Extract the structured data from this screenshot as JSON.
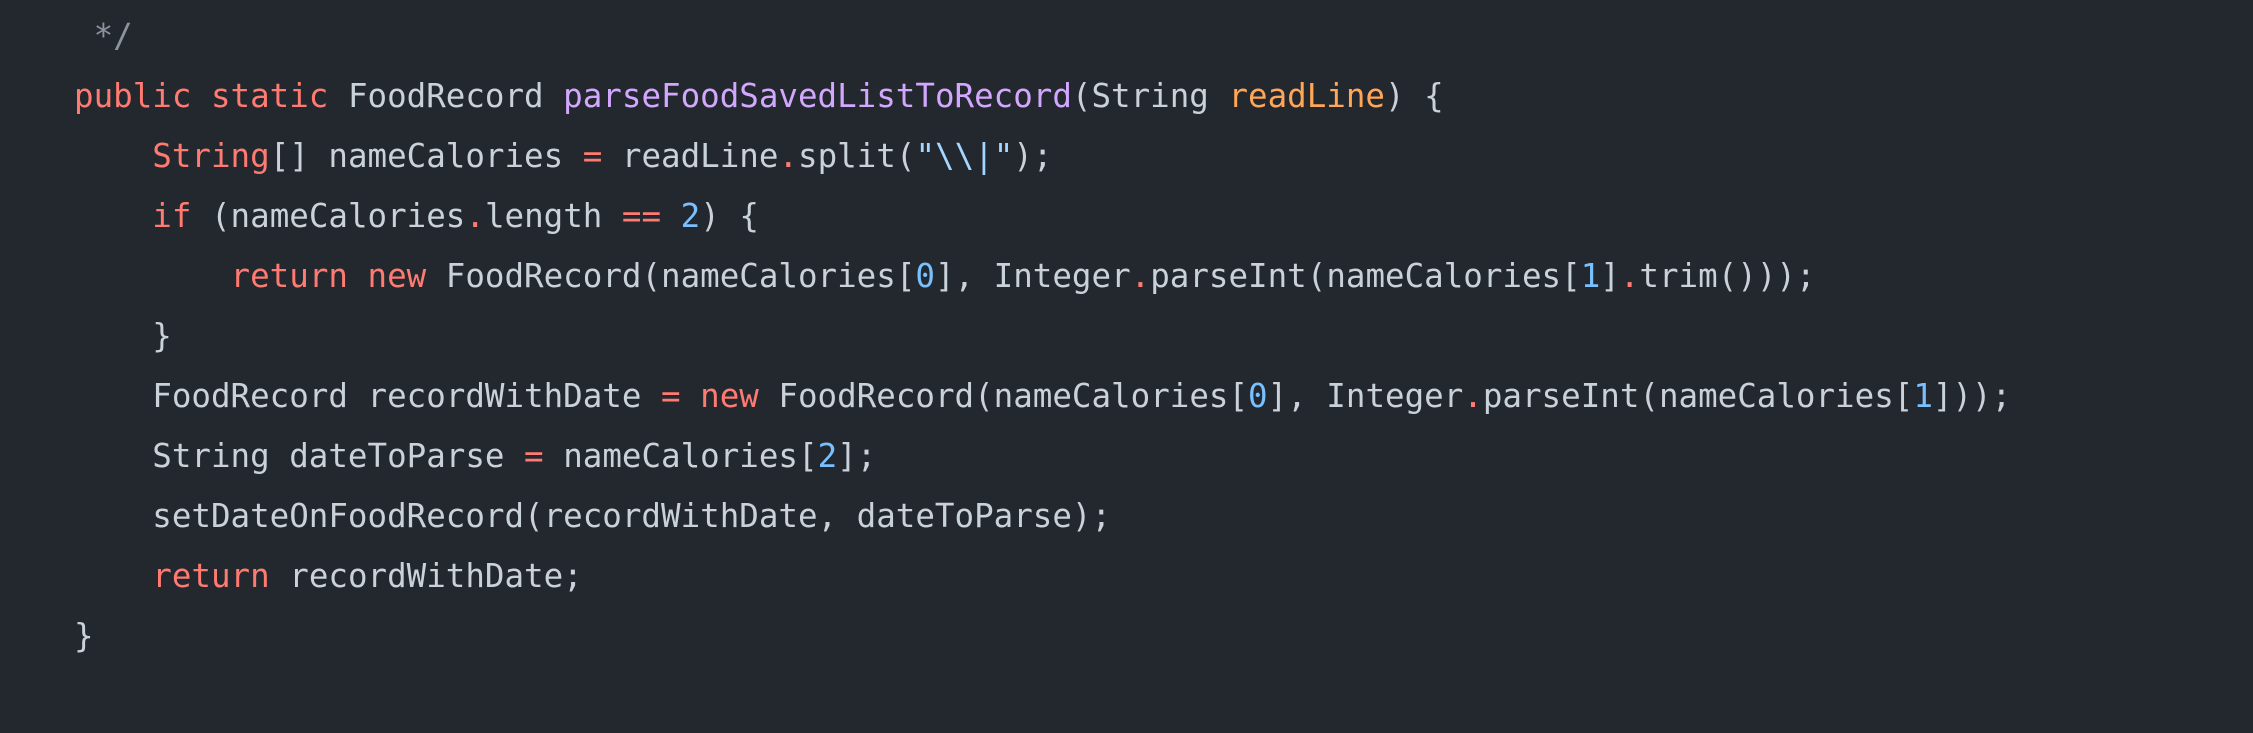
{
  "colors": {
    "background": "#23272e",
    "plain": "#c9d1d9",
    "comment": "#8b949e",
    "keyword": "#ff7b72",
    "function": "#d2a8ff",
    "parameter": "#ffa657",
    "string": "#a5d6ff",
    "number": "#79c0ff"
  },
  "code": {
    "lines": [
      [
        {
          "text": " */",
          "kind": "comment"
        }
      ],
      [
        {
          "text": "public static ",
          "kind": "keyword"
        },
        {
          "text": "FoodRecord ",
          "kind": "plain"
        },
        {
          "text": "parseFoodSavedListToRecord",
          "kind": "function"
        },
        {
          "text": "(String ",
          "kind": "plain"
        },
        {
          "text": "readLine",
          "kind": "parameter"
        },
        {
          "text": ") {",
          "kind": "plain"
        }
      ],
      [
        {
          "text": "    ",
          "kind": "plain"
        },
        {
          "text": "String",
          "kind": "keyword"
        },
        {
          "text": "[] nameCalories ",
          "kind": "plain"
        },
        {
          "text": "=",
          "kind": "keyword"
        },
        {
          "text": " readLine",
          "kind": "plain"
        },
        {
          "text": ".",
          "kind": "keyword"
        },
        {
          "text": "split(",
          "kind": "plain"
        },
        {
          "text": "\"\\\\|\"",
          "kind": "string"
        },
        {
          "text": ");",
          "kind": "plain"
        }
      ],
      [
        {
          "text": "    ",
          "kind": "plain"
        },
        {
          "text": "if",
          "kind": "keyword"
        },
        {
          "text": " (nameCalories",
          "kind": "plain"
        },
        {
          "text": ".",
          "kind": "keyword"
        },
        {
          "text": "length ",
          "kind": "plain"
        },
        {
          "text": "==",
          "kind": "keyword"
        },
        {
          "text": " ",
          "kind": "plain"
        },
        {
          "text": "2",
          "kind": "number"
        },
        {
          "text": ") {",
          "kind": "plain"
        }
      ],
      [
        {
          "text": "        ",
          "kind": "plain"
        },
        {
          "text": "return new ",
          "kind": "keyword"
        },
        {
          "text": "FoodRecord(nameCalories[",
          "kind": "plain"
        },
        {
          "text": "0",
          "kind": "number"
        },
        {
          "text": "], Integer",
          "kind": "plain"
        },
        {
          "text": ".",
          "kind": "keyword"
        },
        {
          "text": "parseInt(nameCalories[",
          "kind": "plain"
        },
        {
          "text": "1",
          "kind": "number"
        },
        {
          "text": "]",
          "kind": "plain"
        },
        {
          "text": ".",
          "kind": "keyword"
        },
        {
          "text": "trim()));",
          "kind": "plain"
        }
      ],
      [
        {
          "text": "    }",
          "kind": "plain"
        }
      ],
      [
        {
          "text": "    FoodRecord recordWithDate ",
          "kind": "plain"
        },
        {
          "text": "=",
          "kind": "keyword"
        },
        {
          "text": " ",
          "kind": "plain"
        },
        {
          "text": "new",
          "kind": "keyword"
        },
        {
          "text": " FoodRecord(nameCalories[",
          "kind": "plain"
        },
        {
          "text": "0",
          "kind": "number"
        },
        {
          "text": "], Integer",
          "kind": "plain"
        },
        {
          "text": ".",
          "kind": "keyword"
        },
        {
          "text": "parseInt(nameCalories[",
          "kind": "plain"
        },
        {
          "text": "1",
          "kind": "number"
        },
        {
          "text": "]));",
          "kind": "plain"
        }
      ],
      [
        {
          "text": "    String dateToParse ",
          "kind": "plain"
        },
        {
          "text": "=",
          "kind": "keyword"
        },
        {
          "text": " nameCalories[",
          "kind": "plain"
        },
        {
          "text": "2",
          "kind": "number"
        },
        {
          "text": "];",
          "kind": "plain"
        }
      ],
      [
        {
          "text": "    setDateOnFoodRecord(recordWithDate, dateToParse);",
          "kind": "plain"
        }
      ],
      [
        {
          "text": "    ",
          "kind": "plain"
        },
        {
          "text": "return",
          "kind": "keyword"
        },
        {
          "text": " recordWithDate;",
          "kind": "plain"
        }
      ],
      [
        {
          "text": "}",
          "kind": "plain"
        }
      ]
    ]
  }
}
